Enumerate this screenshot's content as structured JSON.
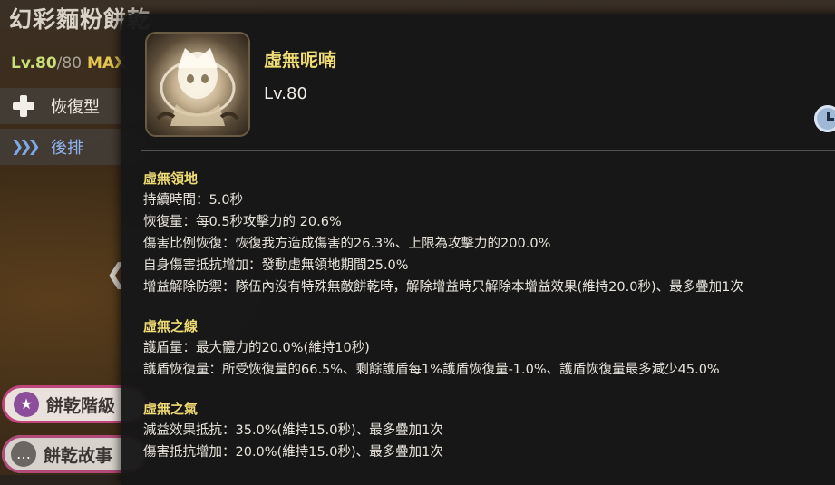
{
  "cookie": {
    "name": "幻彩麵粉餅乾",
    "level_current": "Lv.80",
    "level_max": "/80",
    "max_tag": "MAX",
    "type_label": "恢復型",
    "position_label": "後排"
  },
  "buttons": {
    "grade_label": "餅乾階級",
    "story_label": "餅乾故事"
  },
  "skill": {
    "name": "虛無呢喃",
    "level": "Lv.80",
    "sections": [
      {
        "title": "虛無領地",
        "lines": [
          "持續時間：5.0秒",
          "恢復量：每0.5秒攻擊力的 20.6%",
          "傷害比例恢復：恢復我方造成傷害的26.3%、上限為攻擊力的200.0%",
          "自身傷害抵抗增加：發動虛無領地期間25.0%",
          "增益解除防禦：隊伍內沒有特殊無敵餅乾時，解除增益時只解除本增益效果(維持20.0秒)、最多疊加1次"
        ]
      },
      {
        "title": "虛無之線",
        "lines": [
          "護盾量：最大體力的20.0%(維持10秒)",
          "護盾恢復量：所受恢復量的66.5%、剩餘護盾每1%護盾恢復量-1.0%、護盾恢復量最多減少45.0%"
        ]
      },
      {
        "title": "虛無之氣",
        "lines": [
          "減益效果抵抗：35.0%(維持15.0秒)、最多疊加1次",
          "傷害抵抗增加：20.0%(維持15.0秒)、最多疊加1次"
        ]
      }
    ]
  },
  "icons": {
    "type": "plus-icon",
    "position": "chevron-triple-icon",
    "grade": "star-icon",
    "story": "speech-bubble-icon",
    "cooldown": "clock-icon",
    "back": "chevron-left-icon"
  },
  "colors": {
    "skill_title": "#f0dc74",
    "level_current": "#c9e07a",
    "max_tag": "#e4c54f",
    "position_label": "#8fb4f0",
    "popup_bg": "#171718"
  }
}
